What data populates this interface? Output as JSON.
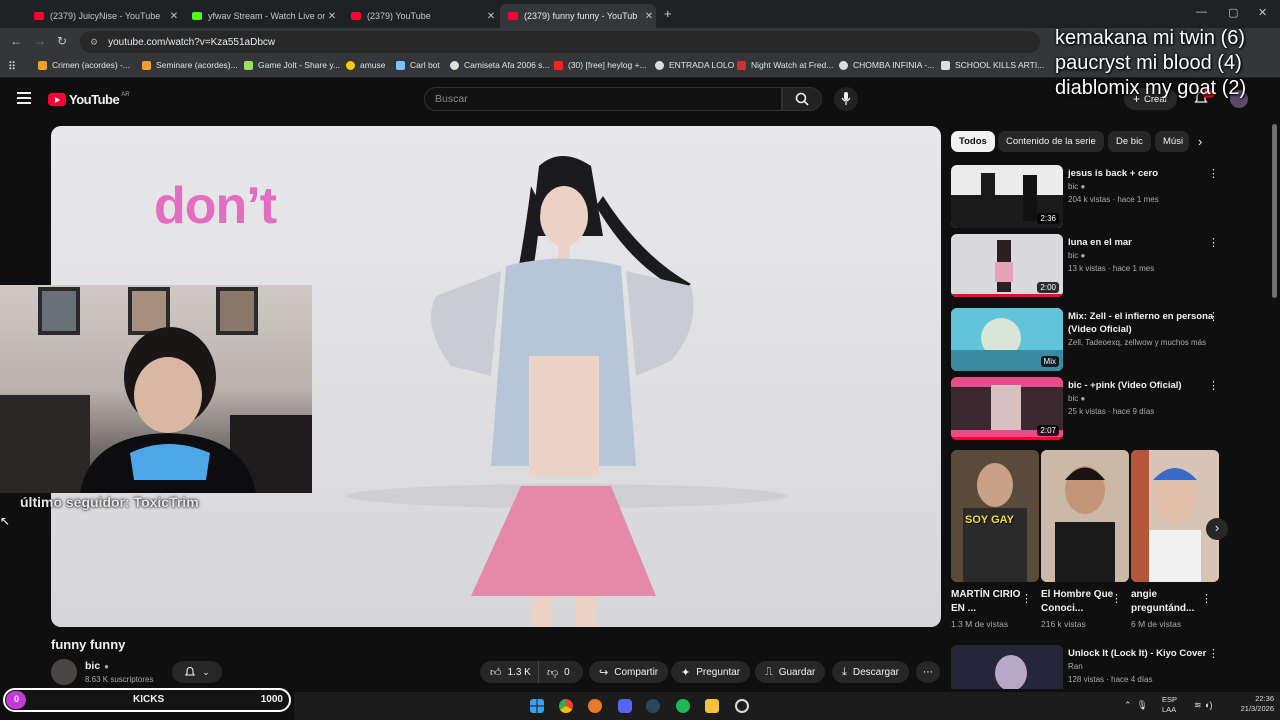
{
  "browser": {
    "tabs": [
      {
        "title": "(2379) JuicyNise - YouTube",
        "favicon": "youtube-icon"
      },
      {
        "title": "yfwav Stream - Watch Live on Ki",
        "favicon": "kick-icon"
      },
      {
        "title": "(2379) YouTube",
        "favicon": "youtube-icon"
      },
      {
        "title": "(2379) funny funny - YouTub",
        "favicon": "youtube-icon",
        "active": true
      }
    ],
    "url": "youtube.com/watch?v=Kza551aDbcw",
    "bookmarks": [
      {
        "label": "Crimen (acordes) -...",
        "color": "#f0a030"
      },
      {
        "label": "Seminare (acordes)...",
        "color": "#f0a030"
      },
      {
        "label": "Game Jolt - Share y...",
        "color": "#9be25a"
      },
      {
        "label": "amuse",
        "color": "#f5d000"
      },
      {
        "label": "Carl bot",
        "color": "#7bc4ff"
      },
      {
        "label": "Camiseta Afa 2006 s...",
        "color": "#dddddd"
      },
      {
        "label": "(30) [free] heylog +...",
        "color": "#ff2020"
      },
      {
        "label": "ENTRADA LOLO",
        "color": "#dddddd"
      },
      {
        "label": "Night Watch at Fred...",
        "color": "#cc3030"
      },
      {
        "label": "CHOMBA INFINIA -...",
        "color": "#dddddd"
      },
      {
        "label": "SCHOOL KILLS ARTI...",
        "color": "#dddddd"
      }
    ]
  },
  "youtube": {
    "logo": "YouTube",
    "country": "AR",
    "search_placeholder": "Buscar",
    "create_label": "Crear",
    "notif_badge": "9+"
  },
  "video": {
    "lyric_text": "don’t",
    "title": "funny funny",
    "channel": "bic",
    "subscribers": "8.63 K suscriptores",
    "likes": "1.3 K",
    "dislikes": "0",
    "share_label": "Compartir",
    "ask_label": "Preguntar",
    "save_label": "Guardar",
    "download_label": "Descargar"
  },
  "stream_overlay": {
    "last_follower": "último seguidor: ToxicTrim",
    "chat_lines": [
      "kemakana mi twin (6)",
      "paucryst mi blood (4)",
      "diablomix my goat (2)"
    ],
    "kicks_label": "KICKS",
    "kicks_current": "0",
    "kicks_goal": "1000",
    "kicks_progress": 0.0
  },
  "chips": [
    "Todos",
    "Contenido de la serie",
    "De bic",
    "Músi"
  ],
  "recommendations": [
    {
      "title": "jesus is back + cero",
      "channel": "bic",
      "meta": "204 k vistas · hace 1 mes",
      "duration": "2:36",
      "thumb_color": "#2a2a2a"
    },
    {
      "title": "luna en el mar",
      "channel": "bic",
      "meta": "13 k vistas · hace 1 mes",
      "duration": "2:00",
      "thumb_color": "#d8d8dc"
    },
    {
      "title": "Mix: Zell - el infierno en persona (Video Oficial)",
      "channel": "Zell, Tadeoexq, zellwow y muchos más",
      "meta": "",
      "duration": "Mix",
      "thumb_color": "#5ec0d8"
    },
    {
      "title": "bic - +pink (Video Oficial)",
      "channel": "bic",
      "meta": "25 k vistas · hace 9 días",
      "duration": "2:07",
      "thumb_color": "#d8a4b8"
    }
  ],
  "shorts": [
    {
      "title": "MARTÍN CIRIO EN ...",
      "views": "1.3 M de vistas",
      "overlay": "SOY GAY",
      "color": "#6a5a4a"
    },
    {
      "title": "El Hombre Que Conoci...",
      "views": "216 k vistas",
      "color": "#c8b4a0"
    },
    {
      "title": "angie preguntánd...",
      "views": "6 M de vistas",
      "color": "#d0b8a8"
    }
  ],
  "last_rec": {
    "title": "Unlock It (Lock It) - Kiyo Cover",
    "channel": "Ran",
    "meta": "128 vistas · hace 4 días"
  },
  "taskbar": {
    "lang": "ESP",
    "layout": "LAA",
    "time": "22:36",
    "date": "21/3/2026"
  }
}
